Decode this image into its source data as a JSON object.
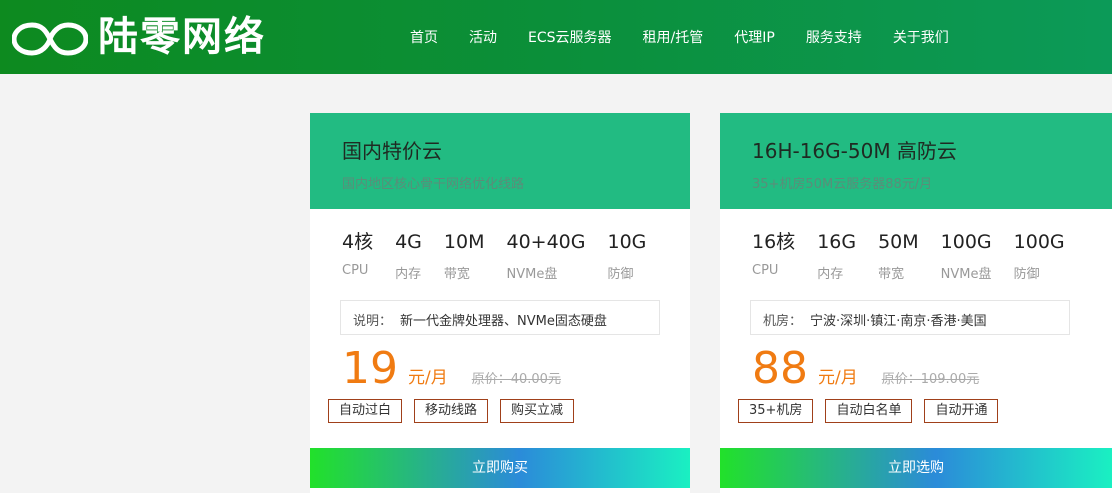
{
  "header": {
    "brand": "陆零网络",
    "nav": [
      "首页",
      "活动",
      "ECS云服务器",
      "租用/托管",
      "代理IP",
      "服务支持",
      "关于我们"
    ]
  },
  "cards": [
    {
      "title": "国内特价云",
      "subtitle": "国内地区核心骨干网络优化线路",
      "specs": [
        {
          "value": "4核",
          "label": "CPU"
        },
        {
          "value": "4G",
          "label": "内存"
        },
        {
          "value": "10M",
          "label": "带宽"
        },
        {
          "value": "40+40G",
          "label": "NVMe盘"
        },
        {
          "value": "10G",
          "label": "防御"
        }
      ],
      "note_label": "说明：",
      "note_text": "新一代金牌处理器、NVMe固态硬盘",
      "price": "19",
      "unit": "元/月",
      "original_price": "原价：40.00元",
      "tags": [
        "自动过白",
        "移动线路",
        "购买立减"
      ],
      "button": "立即购买"
    },
    {
      "title": "16H-16G-50M 高防云",
      "subtitle": "35+机房50M云服务器88元/月",
      "specs": [
        {
          "value": "16核",
          "label": "CPU"
        },
        {
          "value": "16G",
          "label": "内存"
        },
        {
          "value": "50M",
          "label": "带宽"
        },
        {
          "value": "100G",
          "label": "NVMe盘"
        },
        {
          "value": "100G",
          "label": "防御"
        }
      ],
      "note_label": "机房：",
      "note_text": "宁波·深圳·镇江·南京·香港·美国",
      "price": "88",
      "unit": "元/月",
      "original_price": "原价：109.00元",
      "tags": [
        "35+机房",
        "自动白名单",
        "自动开通"
      ],
      "button": "立即选购"
    }
  ],
  "colors": {
    "header_start": "#0d8a1f",
    "header_end": "#0c9a58",
    "card_head": "#22bb82",
    "price": "#f07b12",
    "tag_border": "#a0401a"
  }
}
